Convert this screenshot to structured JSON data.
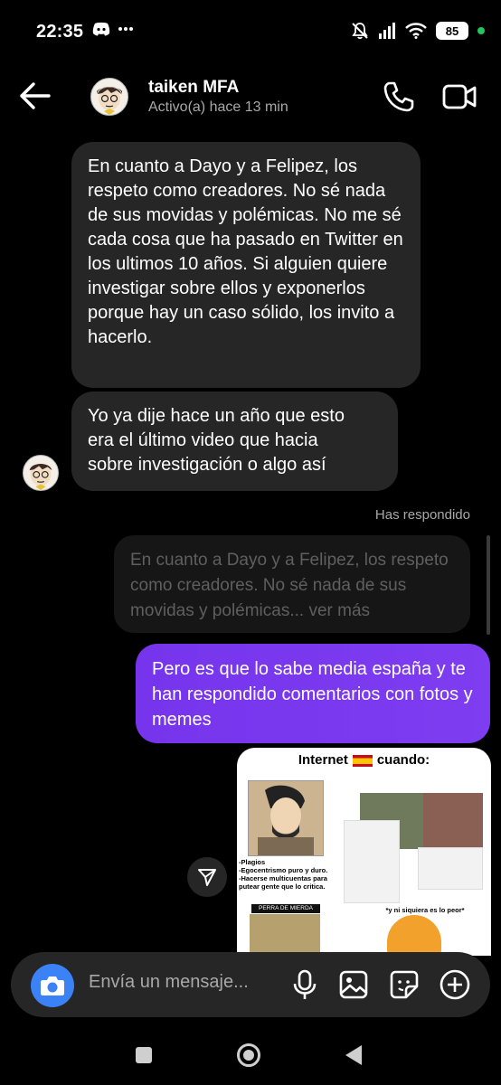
{
  "status_bar": {
    "time": "22:35",
    "battery": "85"
  },
  "header": {
    "name": "taiken MFA",
    "status": "Activo(a) hace 13 min"
  },
  "messages": {
    "incoming_1": "En cuanto a Dayo y a Felipez, los respeto como creadores. No sé nada de sus movidas y polémicas. No me sé cada cosa que ha pasado en Twitter en los ultimos 10 años. Si alguien quiere investigar sobre ellos y exponerlos porque hay un caso sólido, los invito a hacerlo.",
    "incoming_2_lines": [
      "Yo ya dije hace un año que esto",
      "era el último video que hacia",
      "sobre investigación o algo así"
    ],
    "replied_label": "Has respondido",
    "reply_quote": "En cuanto a Dayo y a Felipez, los respeto como creadores. No sé nada de sus movidas y polémicas... ver más",
    "outgoing_1": "Pero es que lo sabe media españa y te han respondido comentarios con fotos y memes"
  },
  "meme": {
    "title_left": "Internet",
    "title_right": "cuando:",
    "caption_1": "-Plagios\n-Egocentrismo puro y duro.\n-Hacerse multicuentas para putear gente que lo critica.",
    "label": "PERRA DE MIERDA",
    "caption_2": "*y ni siquiera es lo peor*"
  },
  "composer": {
    "placeholder": "Envía un mensaje..."
  },
  "colors": {
    "outgoing_bubble": "#7b3aed",
    "incoming_bubble": "#262626",
    "camera_button": "#3b82f6"
  }
}
